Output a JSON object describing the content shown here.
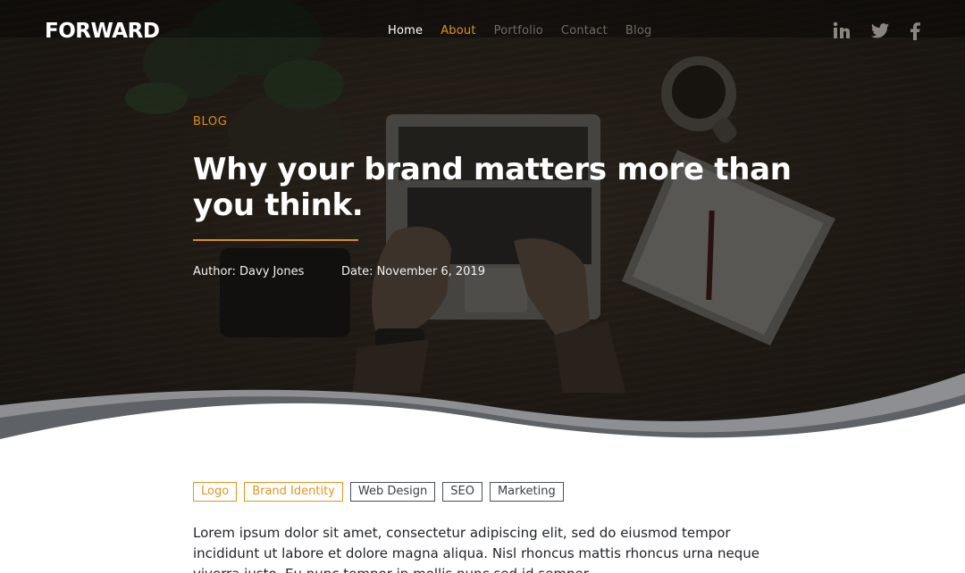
{
  "header": {
    "logo": "FORWARD",
    "nav": [
      {
        "label": "Home"
      },
      {
        "label": "About"
      },
      {
        "label": "Portfolio"
      },
      {
        "label": "Contact"
      },
      {
        "label": "Blog"
      }
    ],
    "social": [
      {
        "icon": "linkedin-icon",
        "glyph": "in"
      },
      {
        "icon": "twitter-icon",
        "glyph": "❧"
      },
      {
        "icon": "facebook-icon",
        "glyph": "f"
      }
    ]
  },
  "hero": {
    "category": "BLOG",
    "title": "Why your brand matters more than you think.",
    "author": "Author: Davy Jones",
    "date": "Date: November 6, 2019"
  },
  "article": {
    "tags": [
      {
        "label": "Logo",
        "style": "orange"
      },
      {
        "label": "Brand Identity",
        "style": "orange"
      },
      {
        "label": "Web Design",
        "style": "dark"
      },
      {
        "label": "SEO",
        "style": "dark"
      },
      {
        "label": "Marketing",
        "style": "dark"
      }
    ],
    "body": "Lorem ipsum dolor sit amet, consectetur adipiscing elit, sed do eiusmod tempor incididunt ut labore et dolore magna aliqua. Nisl rhoncus mattis rhoncus urna neque viverra justo. Eu nunc tempor in mollis nunc sed id semper."
  },
  "colors": {
    "accent": "#e0951f",
    "hero_overlay": "#231c17",
    "text": "#1f2226"
  }
}
